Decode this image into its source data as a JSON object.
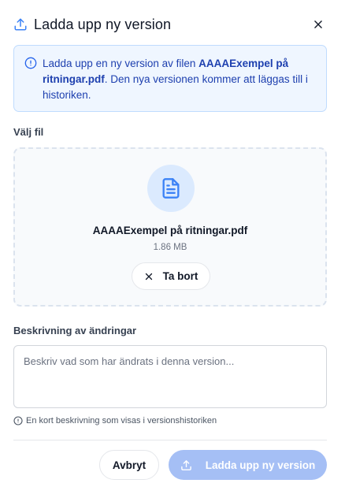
{
  "dialog": {
    "title": "Ladda upp ny version",
    "colors": {
      "accent": "#3b82f6",
      "info_bg": "#eff6ff",
      "info_text": "#1e40af",
      "primary_disabled": "#a5bff5"
    }
  },
  "info": {
    "prefix": "Ladda upp en ny version av filen ",
    "filename": "AAAAExempel på ritningar.pdf",
    "suffix": ". Den nya versionen kommer att läggas till i historiken."
  },
  "file_section": {
    "label": "Välj fil",
    "file_name": "AAAAExempel på ritningar.pdf",
    "file_size": "1.86 MB",
    "remove_label": "Ta bort",
    "file_icon": "document-icon"
  },
  "description": {
    "label": "Beskrivning av ändringar",
    "placeholder": "Beskriv vad som har ändrats i denna version...",
    "value": "",
    "hint": "En kort beskrivning som visas i versionshistoriken"
  },
  "actions": {
    "cancel_label": "Avbryt",
    "submit_label": "Ladda upp ny version",
    "submit_enabled": false
  }
}
